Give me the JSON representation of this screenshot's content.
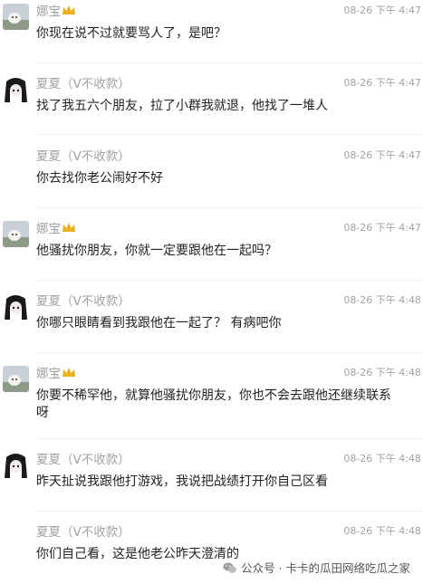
{
  "messages": [
    {
      "sender": "娜宝",
      "time": "08-26 下午 4:47",
      "text": "你现在说不过就要骂人了，是吧？",
      "avatar": "dog-avatar",
      "badge": "crown-icon"
    },
    {
      "sender": "夏夏（V不收款）",
      "time": "08-26 下午 4:47",
      "text": "找了我五六个朋友，拉了小群我就退，他找了一堆人",
      "avatar": "anime-girl-avatar"
    },
    {
      "sender": "夏夏（V不收款）",
      "time": "08-26 下午 4:47",
      "text": "你去找你老公闹好不好"
    },
    {
      "sender": "娜宝",
      "time": "08-26 下午 4:47",
      "text": "他骚扰你朋友，你就一定要跟他在一起吗？",
      "avatar": "dog-avatar",
      "badge": "crown-icon"
    },
    {
      "sender": "夏夏（V不收款）",
      "time": "08-26 下午 4:48",
      "text": "你哪只眼睛看到我跟他在一起了？ 有病吧你",
      "avatar": "anime-girl-avatar"
    },
    {
      "sender": "娜宝",
      "time": "08-26 下午 4:48",
      "text": "你要不稀罕他，就算他骚扰你朋友，你也不会去跟他还继续联系呀",
      "avatar": "dog-avatar",
      "badge": "crown-icon"
    },
    {
      "sender": "夏夏（V不收款）",
      "time": "08-26 下午 4:48",
      "text": "昨天扯说我跟他打游戏，我说把战绩打开你自己区看",
      "avatar": "anime-girl-avatar"
    },
    {
      "sender": "夏夏（V不收款）",
      "time": "08-26 下午 4:48",
      "text": "你们自己看，这是他老公昨天澄清的"
    }
  ],
  "watermark": {
    "text": "公众号 · 卡卡的瓜田网络吃瓜之家",
    "icon": "wechat-icon"
  },
  "colors": {
    "meta": "#a2a2a2",
    "text": "#222222",
    "divider": "#eeeeee",
    "crown": "#e8b020"
  }
}
